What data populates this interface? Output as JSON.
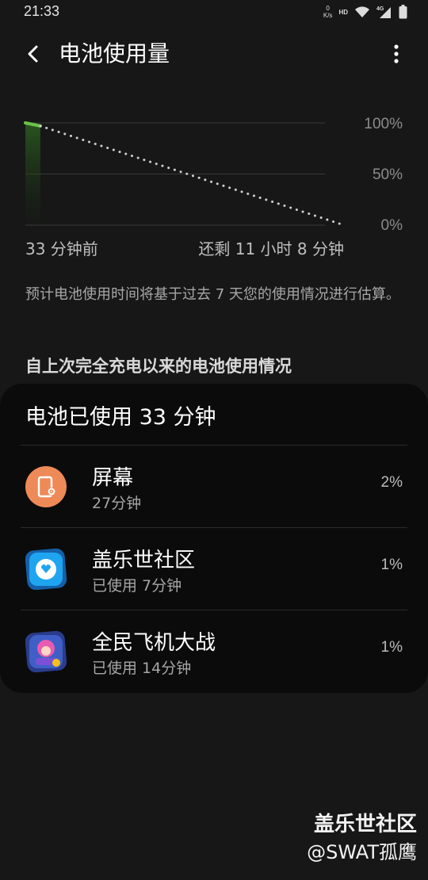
{
  "status_bar": {
    "time": "21:33",
    "net_speed_value": "0",
    "net_speed_unit": "K/s",
    "hd_badge": "HD",
    "network_type": "4G",
    "icons": [
      "wifi-icon",
      "signal-icon",
      "battery-icon"
    ]
  },
  "header": {
    "title": "电池使用量",
    "back_icon": "back-arrow-icon",
    "more_icon": "more-options-icon"
  },
  "chart_data": {
    "type": "line",
    "title": "",
    "xlabel": "",
    "ylabel": "",
    "y_ticks": [
      "100%",
      "50%",
      "0%"
    ],
    "ylim": [
      0,
      100
    ],
    "x_labels": [
      "33 分钟前",
      "还剩 11 小时 8 分钟"
    ],
    "grid": true,
    "series": [
      {
        "style": "solid",
        "color": "#6cc24a",
        "x": [
          -33,
          0
        ],
        "y": [
          100,
          97
        ]
      },
      {
        "style": "dotted",
        "color": "#cfcfcf",
        "x": [
          0,
          668
        ],
        "y": [
          97,
          0
        ]
      }
    ]
  },
  "description": "预计电池使用时间将基于过去 7 天您的使用情况进行估算。",
  "section_title": "自上次完全充电以来的电池使用情况",
  "usage_card": {
    "title": "电池已使用 33 分钟",
    "apps": [
      {
        "name": "屏幕",
        "sub": "27分钟",
        "percent": "2%",
        "icon": "screen-settings-icon",
        "color": "#ee8a58"
      },
      {
        "name": "盖乐世社区",
        "sub": "已使用 7分钟",
        "percent": "1%",
        "icon": "galaxy-community-icon",
        "color": "#1a9be6"
      },
      {
        "name": "全民飞机大战",
        "sub": "已使用 14分钟",
        "percent": "1%",
        "icon": "game-app-icon",
        "color": "#3f5fc7"
      }
    ]
  },
  "watermark": {
    "line1": "盖乐世社区",
    "line2": "@SWAT孤鹰"
  }
}
